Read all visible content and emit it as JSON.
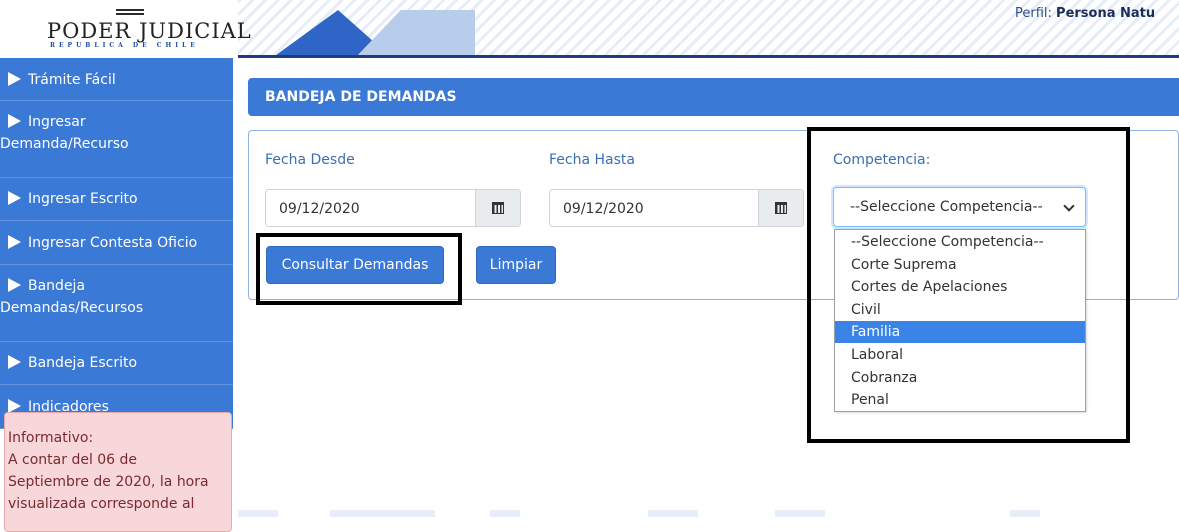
{
  "header": {
    "logo_title": "PODER JUDICIAL",
    "logo_subtitle": "REPUBLICA DE CHILE",
    "perfil_label": "Perfil:",
    "perfil_value": "Persona Natu"
  },
  "sidebar": {
    "items": [
      {
        "line1": "Trámite Fácil",
        "line2": ""
      },
      {
        "line1": "Ingresar",
        "line2": "Demanda/Recurso"
      },
      {
        "line1": "Ingresar Escrito",
        "line2": ""
      },
      {
        "line1": "Ingresar Contesta Oficio",
        "line2": ""
      },
      {
        "line1": "Bandeja",
        "line2": "Demandas/Recursos"
      },
      {
        "line1": "Bandeja Escrito",
        "line2": ""
      },
      {
        "line1": "Indicadores",
        "line2": ""
      }
    ],
    "info": {
      "title": "Informativo:",
      "lines": [
        "A contar del 06 de",
        "Septiembre de 2020, la hora",
        "visualizada corresponde al"
      ]
    }
  },
  "main": {
    "panel_title": "BANDEJA DE DEMANDAS",
    "fecha_desde_label": "Fecha Desde",
    "fecha_desde_value": "09/12/2020",
    "fecha_hasta_label": "Fecha Hasta",
    "fecha_hasta_value": "09/12/2020",
    "competencia_label": "Competencia:",
    "competencia_selected": "--Seleccione Competencia--",
    "competencia_options": [
      "--Seleccione Competencia--",
      "Corte Suprema",
      "Cortes de Apelaciones",
      "Civil",
      "Familia",
      "Laboral",
      "Cobranza",
      "Penal"
    ],
    "highlighted_option": "Familia",
    "consultar_label": "Consultar Demandas",
    "limpiar_label": "Limpiar"
  },
  "colors": {
    "primary": "#3a79d6",
    "info_bg": "#f8d7da",
    "highlight": "#3a84e8"
  }
}
